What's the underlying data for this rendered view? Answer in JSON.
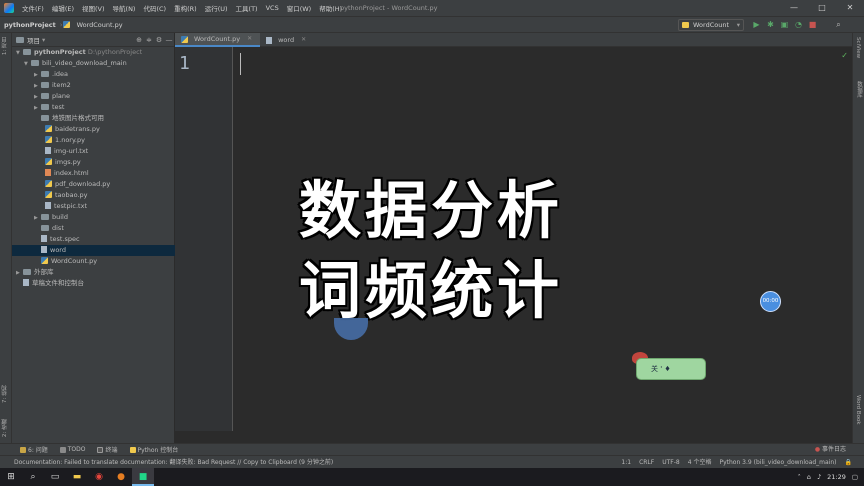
{
  "menu": {
    "items": [
      "文件(F)",
      "编辑(E)",
      "视图(V)",
      "导航(N)",
      "代码(C)",
      "重构(R)",
      "运行(U)",
      "工具(T)",
      "VCS",
      "窗口(W)",
      "帮助(H)"
    ],
    "window_title": "pythonProject - WordCount.py",
    "minimize": "—",
    "maximize": "□",
    "close": "✕"
  },
  "navbar": {
    "project": "pythonProject",
    "file": "WordCount.py",
    "run_config": "WordCount"
  },
  "left_strip": {
    "project_tab": "1: 项目",
    "structure_tab": "7: 结构",
    "favorites_tab": "2: 收藏"
  },
  "project_panel": {
    "header": "项目",
    "root": "pythonProject",
    "root_path": "D:\\pythonProject",
    "items": [
      {
        "label": "bili_video_download_main",
        "kind": "folder"
      },
      {
        "label": ".idea",
        "kind": "folder"
      },
      {
        "label": "item2",
        "kind": "folder"
      },
      {
        "label": "plane",
        "kind": "folder"
      },
      {
        "label": "test",
        "kind": "folder"
      },
      {
        "label": "地铁图片格式可用",
        "kind": "folder"
      },
      {
        "label": "baidetrans.py",
        "kind": "py"
      },
      {
        "label": "1.nory.py",
        "kind": "py"
      },
      {
        "label": "img-url.txt",
        "kind": "file"
      },
      {
        "label": "imgs.py",
        "kind": "py"
      },
      {
        "label": "index.html",
        "kind": "file"
      },
      {
        "label": "pdf_download.py",
        "kind": "py"
      },
      {
        "label": "taobao.py",
        "kind": "py"
      },
      {
        "label": "testpic.txt",
        "kind": "file"
      },
      {
        "label": "build",
        "kind": "folder"
      },
      {
        "label": "dist",
        "kind": "folder"
      },
      {
        "label": "test.spec",
        "kind": "file"
      },
      {
        "label": "word",
        "kind": "file"
      },
      {
        "label": "WordCount.py",
        "kind": "py"
      },
      {
        "label": "外部库",
        "kind": "folder"
      },
      {
        "label": "草稿文件和控制台",
        "kind": "file"
      }
    ]
  },
  "editor": {
    "tabs": [
      {
        "label": "WordCount.py"
      },
      {
        "label": "word"
      }
    ],
    "line_number": "1"
  },
  "overlay": {
    "line1": "数据分析",
    "line2": "词频统计"
  },
  "widgets": {
    "timer": "00:00",
    "mascot_text": "关 ' ♦"
  },
  "right_strip": {
    "scientific_view": "SciView",
    "database": "数据库",
    "word_book": "Word Book"
  },
  "bottom_toolbar": {
    "items": [
      "6: 问题",
      "TODO",
      "终端",
      "Python 控制台"
    ],
    "event_log": "事件日志"
  },
  "status": {
    "message": "Documentation: Failed to translate documentation: 翻译失败: Bad Request // Copy to Clipboard (9 分钟之前)",
    "position": "1:1",
    "line_ending": "CRLF",
    "encoding": "UTF-8",
    "indent": "4 个空格",
    "interpreter": "Python 3.9 (bili_video_download_main)"
  },
  "taskbar": {
    "time": "21:29"
  },
  "colors": {
    "accent": "#4a88c7",
    "background": "#2b2b2b",
    "panel": "#3c3f41",
    "selection": "#0d293e"
  }
}
